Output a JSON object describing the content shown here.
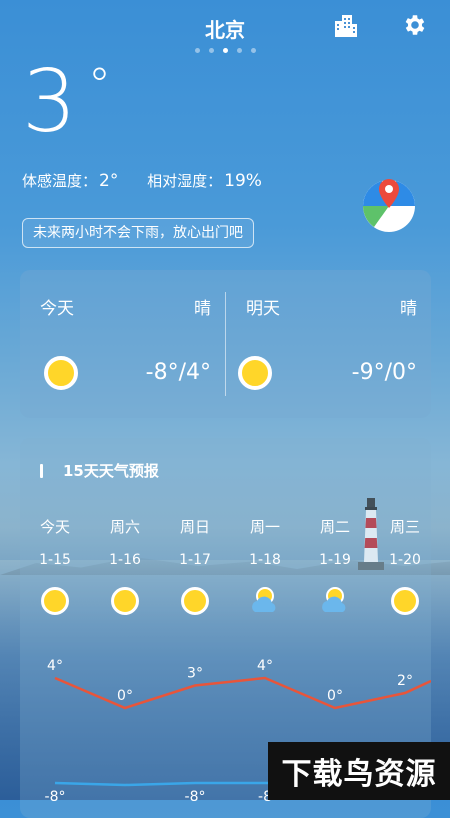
{
  "header": {
    "city": "北京",
    "pages": 5,
    "active_page": 3
  },
  "current": {
    "temp": "3",
    "deg": "°",
    "feels_label": "体感温度：",
    "feels_value": "2°",
    "humidity_label": "相对湿度：",
    "humidity_value": "19%",
    "tip": "未来两小时不会下雨，放心出门吧"
  },
  "summary": {
    "today": {
      "day": "今天",
      "cond": "晴",
      "range": "-8°/4°",
      "icon": "sun-icon"
    },
    "tomorrow": {
      "day": "明天",
      "cond": "晴",
      "range": "-9°/0°",
      "icon": "sun-icon"
    }
  },
  "forecast": {
    "title": "15天天气预报",
    "days": [
      {
        "week": "今天",
        "date": "1-15",
        "icon": "sun-icon",
        "high": "4°",
        "low": "-8°"
      },
      {
        "week": "周六",
        "date": "1-16",
        "icon": "sun-icon",
        "high": "0°",
        "low": ""
      },
      {
        "week": "周日",
        "date": "1-17",
        "icon": "sun-icon",
        "high": "3°",
        "low": "-8°"
      },
      {
        "week": "周一",
        "date": "1-18",
        "icon": "partly-cloudy-icon",
        "high": "4°",
        "low": "-8"
      },
      {
        "week": "周二",
        "date": "1-19",
        "icon": "partly-cloudy-icon",
        "high": "0°",
        "low": ""
      },
      {
        "week": "周三",
        "date": "1-20",
        "icon": "sun-icon",
        "high": "2°",
        "low": ""
      }
    ],
    "chart_data": {
      "type": "line",
      "categories": [
        "今天",
        "周六",
        "周日",
        "周一",
        "周二",
        "周三"
      ],
      "series": [
        {
          "values": [
            4,
            0,
            3,
            4,
            0,
            2
          ],
          "color": "#e8553a"
        },
        {
          "values": [
            -8,
            -9,
            -8,
            -8,
            -8,
            -8
          ],
          "color": "#3aa6e8"
        }
      ]
    }
  },
  "watermark": "下载鸟资源",
  "colors": {
    "sun": "#ffd629",
    "high_line": "#e8553a",
    "low_line": "#3aa6e8"
  }
}
